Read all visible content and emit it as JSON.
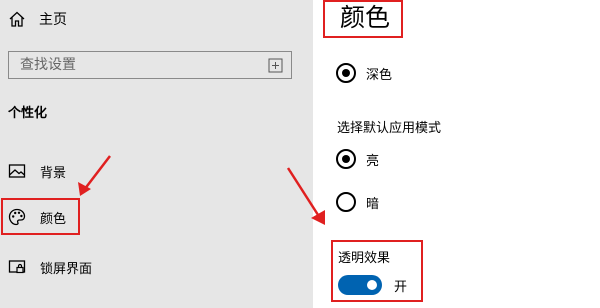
{
  "sidebar": {
    "home_label": "主页",
    "search": {
      "placeholder": "查找设置",
      "value": ""
    },
    "section_title": "个性化",
    "items": [
      {
        "label": "背景",
        "icon": "image-icon"
      },
      {
        "label": "颜色",
        "icon": "palette-icon"
      },
      {
        "label": "锁屏界面",
        "icon": "lock-screen-icon"
      }
    ]
  },
  "main": {
    "title": "颜色",
    "options": [
      {
        "label": "深色",
        "checked": true
      }
    ],
    "mode_label": "选择默认应用模式",
    "mode_options": [
      {
        "label": "亮",
        "checked": true
      },
      {
        "label": "暗",
        "checked": false
      }
    ],
    "transparency": {
      "label": "透明效果",
      "state_label": "开",
      "on": true
    }
  },
  "colors": {
    "sidebar_bg": "#e6e6e6",
    "accent": "#0063b1",
    "highlight": "#e02020"
  }
}
